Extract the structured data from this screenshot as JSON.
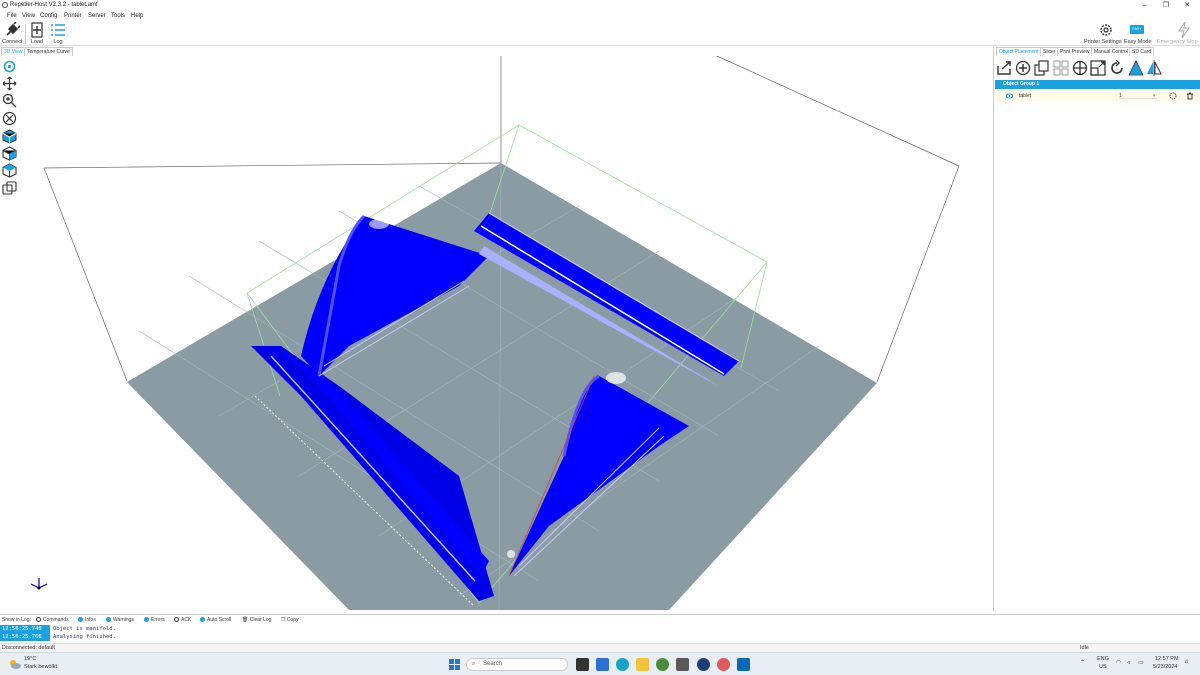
{
  "window": {
    "title": "Repetier-Host V2.3.2 - tablet.amf",
    "minimize": "–",
    "maximize": "❐",
    "close": "✕"
  },
  "menu": [
    "File",
    "View",
    "Config",
    "Printer",
    "Server",
    "Tools",
    "Help"
  ],
  "toolbar": {
    "connect": "Connect",
    "load": "Load",
    "log": "Log",
    "printer_settings": "Printer Settings",
    "easy_mode": "Easy Mode",
    "easy_badge": "EASY",
    "emergency_stop": "Emergency Stop"
  },
  "left_tabs": [
    "3D View",
    "Temperature Curve"
  ],
  "right_tabs": [
    "Object Placement",
    "Slicer",
    "Print Preview",
    "Manual Control",
    "SD Card"
  ],
  "object_panel": {
    "group_name": "Object Group 1",
    "object_name": "tablet",
    "copies": "1"
  },
  "log": {
    "show_in_log": "Show in Log:",
    "options": [
      {
        "label": "Commands",
        "checked": false
      },
      {
        "label": "Infos",
        "checked": true
      },
      {
        "label": "Warnings",
        "checked": true
      },
      {
        "label": "Errors",
        "checked": true
      },
      {
        "label": "ACK",
        "checked": false
      },
      {
        "label": "Auto Scroll",
        "checked": true
      }
    ],
    "clear_log": "Clear Log",
    "copy": "Copy",
    "lines": [
      {
        "time": "12:56:25.748",
        "message": "Object is manifold."
      },
      {
        "time": "12:56:25.766",
        "message": "Analysing finished."
      }
    ]
  },
  "status": {
    "connection": "Disconnected: default",
    "state": "Idle"
  },
  "taskbar": {
    "weather_temp": "19°C",
    "weather_desc": "Stark bewölkt",
    "search_placeholder": "Search",
    "lang": "ENG",
    "region": "US",
    "time": "12:57 PM",
    "date": "5/23/2024"
  },
  "colors": {
    "accent": "#1ba1e2",
    "model": "#0000ff",
    "bed": "#8a9ba3"
  }
}
